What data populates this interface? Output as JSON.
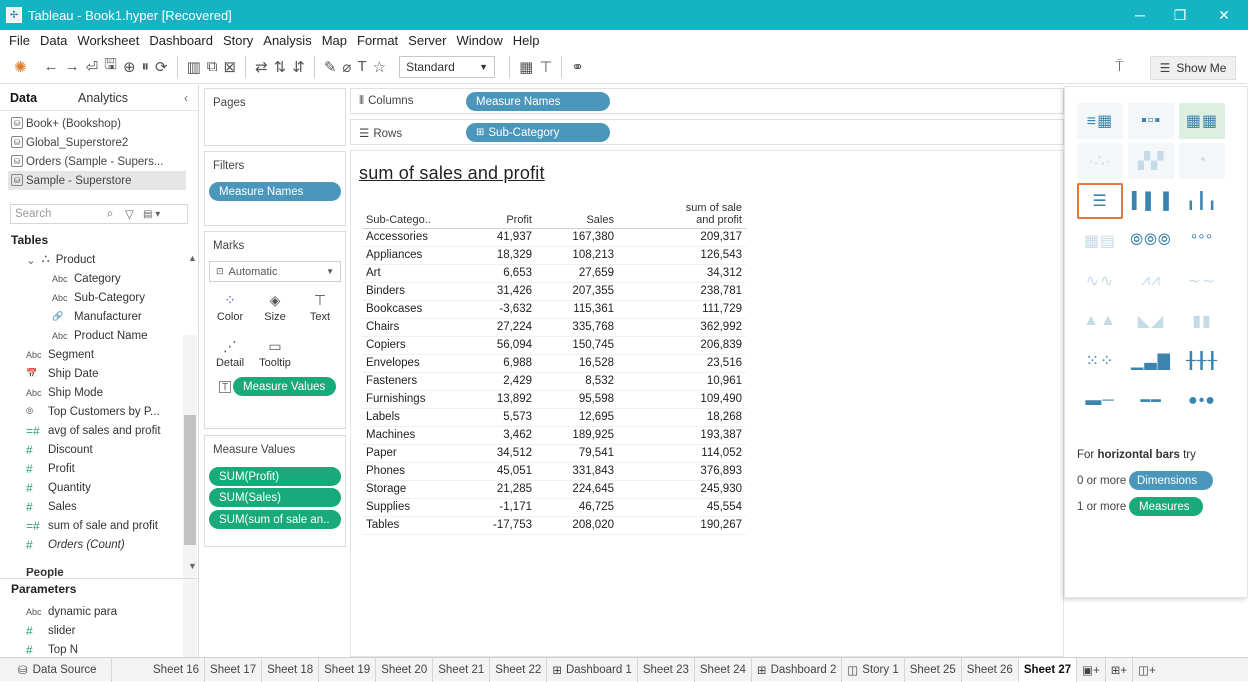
{
  "window": {
    "title": "Tableau - Book1.hyper [Recovered]"
  },
  "menu": [
    "File",
    "Data",
    "Worksheet",
    "Dashboard",
    "Story",
    "Analysis",
    "Map",
    "Format",
    "Server",
    "Window",
    "Help"
  ],
  "toolbar": {
    "fit_select": "Standard",
    "show_me": "Show Me"
  },
  "data_pane": {
    "tab_data": "Data",
    "tab_analytics": "Analytics",
    "sources": [
      "Book+ (Bookshop)",
      "Global_Superstore2",
      "Orders (Sample - Supers...",
      "Sample - Superstore"
    ],
    "search_placeholder": "Search",
    "tables_header": "Tables",
    "product_group": "Product",
    "fields": [
      {
        "type": "Abc",
        "name": "Category"
      },
      {
        "type": "Abc",
        "name": "Sub-Category"
      },
      {
        "type": "link",
        "name": "Manufacturer"
      },
      {
        "type": "Abc",
        "name": "Product Name"
      },
      {
        "type": "Abc",
        "name": "Segment"
      },
      {
        "type": "date",
        "name": "Ship Date"
      },
      {
        "type": "Abc",
        "name": "Ship Mode"
      },
      {
        "type": "set",
        "name": "Top Customers by P..."
      },
      {
        "type": "=#",
        "name": "avg of sales and profit"
      },
      {
        "type": "#",
        "name": "Discount"
      },
      {
        "type": "#",
        "name": "Profit"
      },
      {
        "type": "#",
        "name": "Quantity"
      },
      {
        "type": "#",
        "name": "Sales"
      },
      {
        "type": "=#",
        "name": "sum of sale and profit"
      },
      {
        "type": "#",
        "name": "Orders (Count)"
      }
    ],
    "people_group": "People",
    "parameters_header": "Parameters",
    "parameters": [
      {
        "type": "Abc",
        "name": "dynamic para"
      },
      {
        "type": "#",
        "name": "slider"
      },
      {
        "type": "#",
        "name": "Top N"
      }
    ]
  },
  "cards": {
    "pages": "Pages",
    "filters": "Filters",
    "filter_pill": "Measure Names",
    "marks": "Marks",
    "marks_type": "Automatic",
    "mark_buttons": [
      "Color",
      "Size",
      "Text",
      "Detail",
      "Tooltip"
    ],
    "marks_pill": "Measure Values",
    "measure_values": "Measure Values",
    "measure_pills": [
      "SUM(Profit)",
      "SUM(Sales)",
      "SUM(sum of sale an.."
    ]
  },
  "shelves": {
    "columns_label": "Columns",
    "columns_pill": "Measure Names",
    "rows_label": "Rows",
    "rows_pill": "Sub-Category"
  },
  "view": {
    "title": "sum of sales and profit",
    "table": {
      "headers": [
        "Sub-Catego..",
        "Profit",
        "Sales",
        "sum of sale and profit"
      ],
      "rows": [
        [
          "Accessories",
          "41,937",
          "167,380",
          "209,317"
        ],
        [
          "Appliances",
          "18,329",
          "108,213",
          "126,543"
        ],
        [
          "Art",
          "6,653",
          "27,659",
          "34,312"
        ],
        [
          "Binders",
          "31,426",
          "207,355",
          "238,781"
        ],
        [
          "Bookcases",
          "-3,632",
          "115,361",
          "111,729"
        ],
        [
          "Chairs",
          "27,224",
          "335,768",
          "362,992"
        ],
        [
          "Copiers",
          "56,094",
          "150,745",
          "206,839"
        ],
        [
          "Envelopes",
          "6,988",
          "16,528",
          "23,516"
        ],
        [
          "Fasteners",
          "2,429",
          "8,532",
          "10,961"
        ],
        [
          "Furnishings",
          "13,892",
          "95,598",
          "109,490"
        ],
        [
          "Labels",
          "5,573",
          "12,695",
          "18,268"
        ],
        [
          "Machines",
          "3,462",
          "189,925",
          "193,387"
        ],
        [
          "Paper",
          "34,512",
          "79,541",
          "114,052"
        ],
        [
          "Phones",
          "45,051",
          "331,843",
          "376,893"
        ],
        [
          "Storage",
          "21,285",
          "224,645",
          "245,930"
        ],
        [
          "Supplies",
          "-1,171",
          "46,725",
          "45,554"
        ],
        [
          "Tables",
          "-17,753",
          "208,020",
          "190,267"
        ]
      ]
    }
  },
  "show_me": {
    "hint_prefix": "For ",
    "hint_chart": "horizontal bars",
    "hint_suffix": " try",
    "dim_prefix": "0 or more",
    "dim_pill": "Dimensions",
    "meas_prefix": "1 or more",
    "meas_pill": "Measures"
  },
  "tabs": {
    "data_source": "Data Source",
    "sheets": [
      "Sheet 16",
      "Sheet 17",
      "Sheet 18",
      "Sheet 19",
      "Sheet 20",
      "Sheet 21",
      "Sheet 22",
      "Dashboard 1",
      "Sheet 23",
      "Sheet 24",
      "Dashboard 2",
      "Story 1",
      "Sheet 25",
      "Sheet 26",
      "Sheet 27"
    ],
    "active": "Sheet 27"
  },
  "colors": {
    "titlebar": "#16b3c3",
    "blue_pill": "#4b97bc",
    "green_pill": "#18aa7b"
  }
}
